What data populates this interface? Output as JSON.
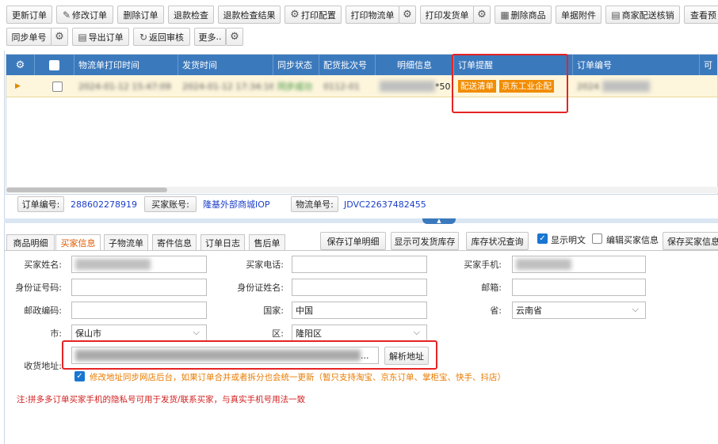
{
  "toolbar": {
    "row1": [
      "更新订单",
      "修改订单",
      "删除订单",
      "退款检查",
      "退款检查结果",
      "打印配置",
      "打印物流单",
      "打印发货单",
      "删除商品",
      "单据附件",
      "商家配送核销",
      "查看预"
    ],
    "row2": [
      "同步单号",
      "导出订单",
      "返回审核",
      "更多"
    ]
  },
  "grid": {
    "headers": [
      "物流单打印时间",
      "发货时间",
      "同步状态",
      "配货批次号",
      "明细信息",
      "订单提醒",
      "订单编号",
      "可"
    ],
    "row": {
      "print_time": "2024-01-12 15:47:09",
      "ship_time": "2024-01-12 17:34:16",
      "sync_status": "同步成功",
      "batch_no": "0112-01",
      "detail_suffix": "*50",
      "badges": [
        "配送清单",
        "京东工业企配"
      ],
      "order_no": "2024"
    }
  },
  "info_bar": {
    "order_no_label": "订单编号:",
    "order_no": "288602278919",
    "buyer_account_label": "买家账号:",
    "buyer_account": "隆基外部商城IOP",
    "logistics_label": "物流单号:",
    "logistics_no": "JDVC22637482455"
  },
  "tabs": [
    "商品明细",
    "买家信息",
    "子物流单",
    "寄件信息",
    "订单日志",
    "售后单"
  ],
  "tab_actions": {
    "save_detail": "保存订单明细",
    "show_stock": "显示可发货库存",
    "stock_query": "库存状况查询",
    "show_plain": "显示明文",
    "edit_buyer": "编辑买家信息",
    "save_buyer": "保存买家信息"
  },
  "form": {
    "buyer_name": "买家姓名:",
    "buyer_phone": "买家电话:",
    "buyer_mobile": "买家手机:",
    "id_no": "身份证号码:",
    "id_name": "身份证姓名:",
    "email": "邮箱:",
    "zip": "邮政编码:",
    "country": "国家:",
    "country_value": "中国",
    "province": "省:",
    "province_value": "云南省",
    "city": "市:",
    "city_value": "保山市",
    "district": "区:",
    "district_value": "隆阳区",
    "address": "收货地址:",
    "parse_address": "解析地址",
    "sync_note": "修改地址同步网店后台，如果订单合并或者拆分也会统一更新（暂只支持淘宝、京东订单、掌柜宝、快手、抖店）",
    "warning": "注:拼多多订单买家手机的隐私号可用于发货/联系买家，与真实手机号用法一致"
  }
}
